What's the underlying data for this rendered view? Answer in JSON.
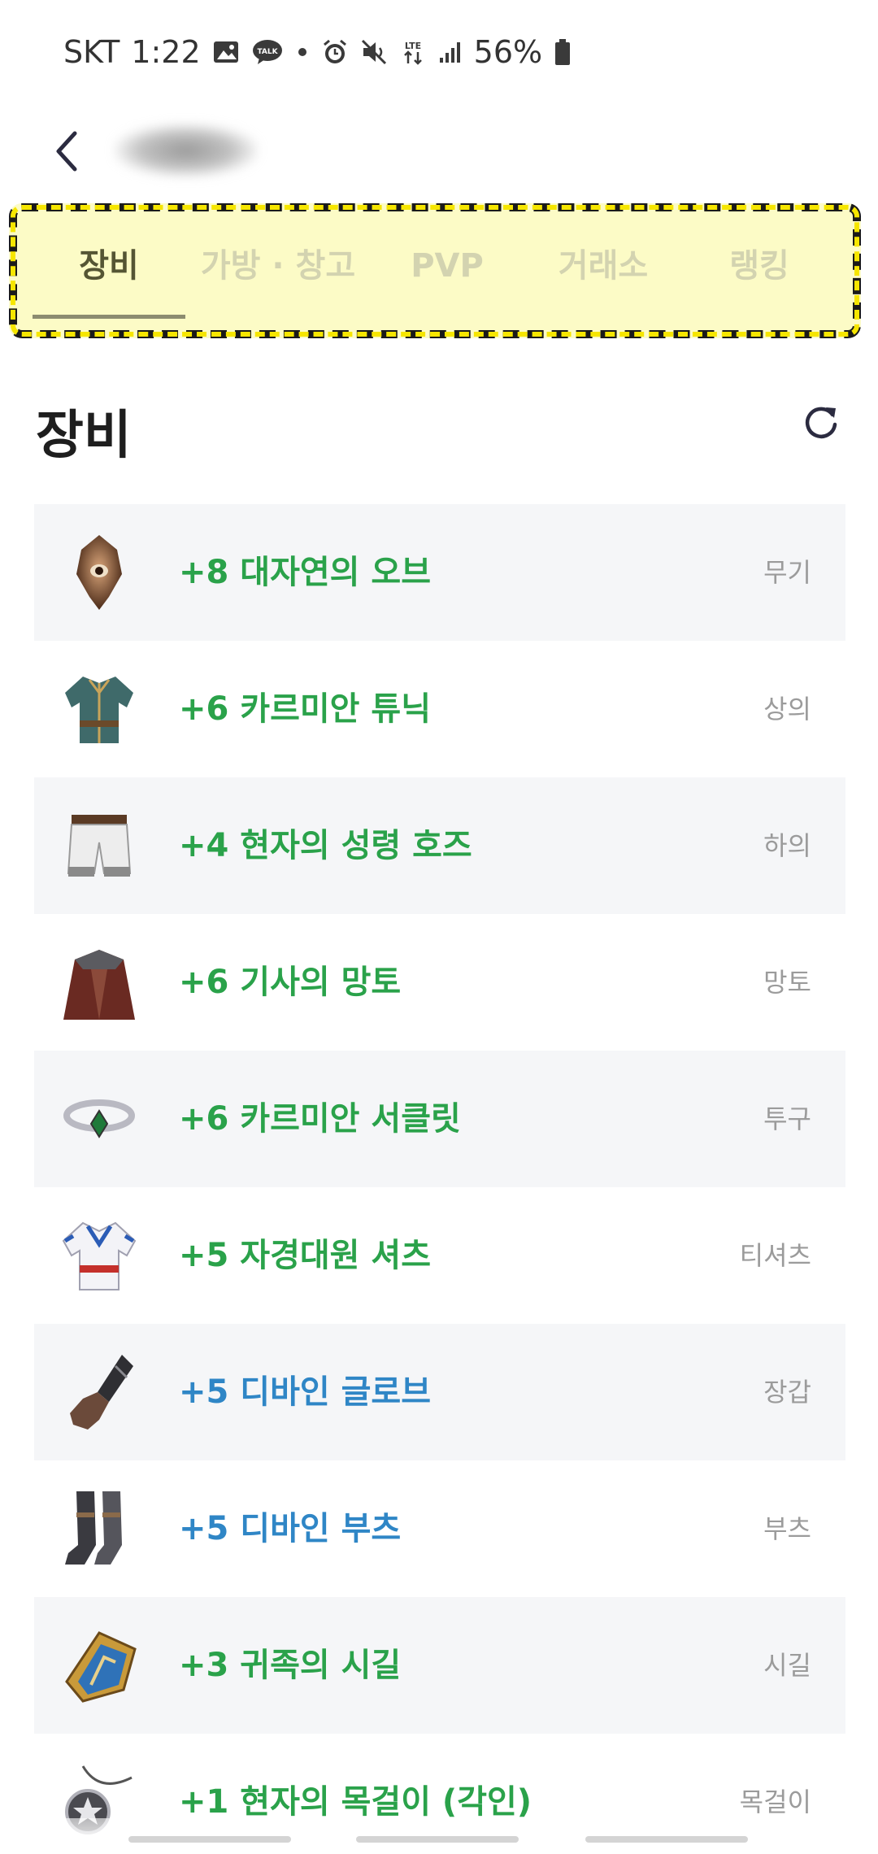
{
  "status_bar": {
    "carrier": "SKT",
    "time": "1:22",
    "network": "LTE",
    "battery": "56%"
  },
  "tabs": [
    {
      "label": "장비",
      "active": true
    },
    {
      "label": "가방 · 창고",
      "active": false
    },
    {
      "label": "PVP",
      "active": false
    },
    {
      "label": "거래소",
      "active": false
    },
    {
      "label": "랭킹",
      "active": false
    }
  ],
  "section": {
    "title": "장비"
  },
  "items": [
    {
      "name": "+8 대자연의 오브",
      "type": "무기",
      "color": "#2aa24a",
      "icon": "orb-icon"
    },
    {
      "name": "+6 카르미안 튜닉",
      "type": "상의",
      "color": "#2aa24a",
      "icon": "tunic-icon"
    },
    {
      "name": "+4 현자의 성령 호즈",
      "type": "하의",
      "color": "#2aa24a",
      "icon": "pants-icon"
    },
    {
      "name": "+6 기사의 망토",
      "type": "망토",
      "color": "#2aa24a",
      "icon": "cloak-icon"
    },
    {
      "name": "+6 카르미안 서클릿",
      "type": "투구",
      "color": "#2aa24a",
      "icon": "circlet-icon"
    },
    {
      "name": "+5 자경대원 셔츠",
      "type": "티셔츠",
      "color": "#2aa24a",
      "icon": "shirt-icon"
    },
    {
      "name": "+5 디바인 글로브",
      "type": "장갑",
      "color": "#2f86c6",
      "icon": "glove-icon"
    },
    {
      "name": "+5 디바인 부츠",
      "type": "부츠",
      "color": "#2f86c6",
      "icon": "boots-icon"
    },
    {
      "name": "+3 귀족의 시길",
      "type": "시길",
      "color": "#2aa24a",
      "icon": "sigil-icon"
    },
    {
      "name": "+1 현자의 목걸이 (각인)",
      "type": "목걸이",
      "color": "#2aa24a",
      "icon": "necklace-icon"
    }
  ]
}
